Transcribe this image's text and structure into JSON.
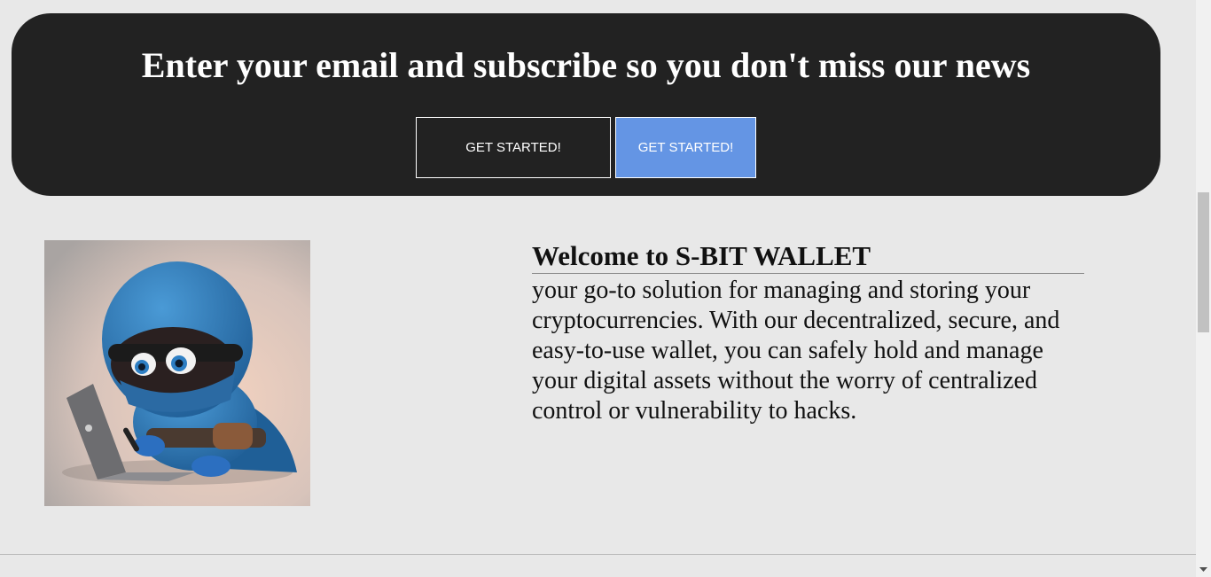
{
  "subscribe": {
    "heading": "Enter your email and subscribe so you don't miss our news",
    "primary_button_label": "GET STARTED!",
    "secondary_button_label": "GET STARTED!"
  },
  "welcome": {
    "title": "Welcome to S-BIT WALLET",
    "body": "your go-to solution for managing and storing your cryptocurrencies. With our decentralized, secure, and easy-to-use wallet, you can safely hold and manage your digital assets without the worry of centralized control or vulnerability to hacks."
  },
  "colors": {
    "page_background": "#e8e8e8",
    "banner_background": "#222222",
    "accent_button": "#6495e4"
  },
  "icons": {
    "scroll_down": "chevron-down-icon"
  }
}
